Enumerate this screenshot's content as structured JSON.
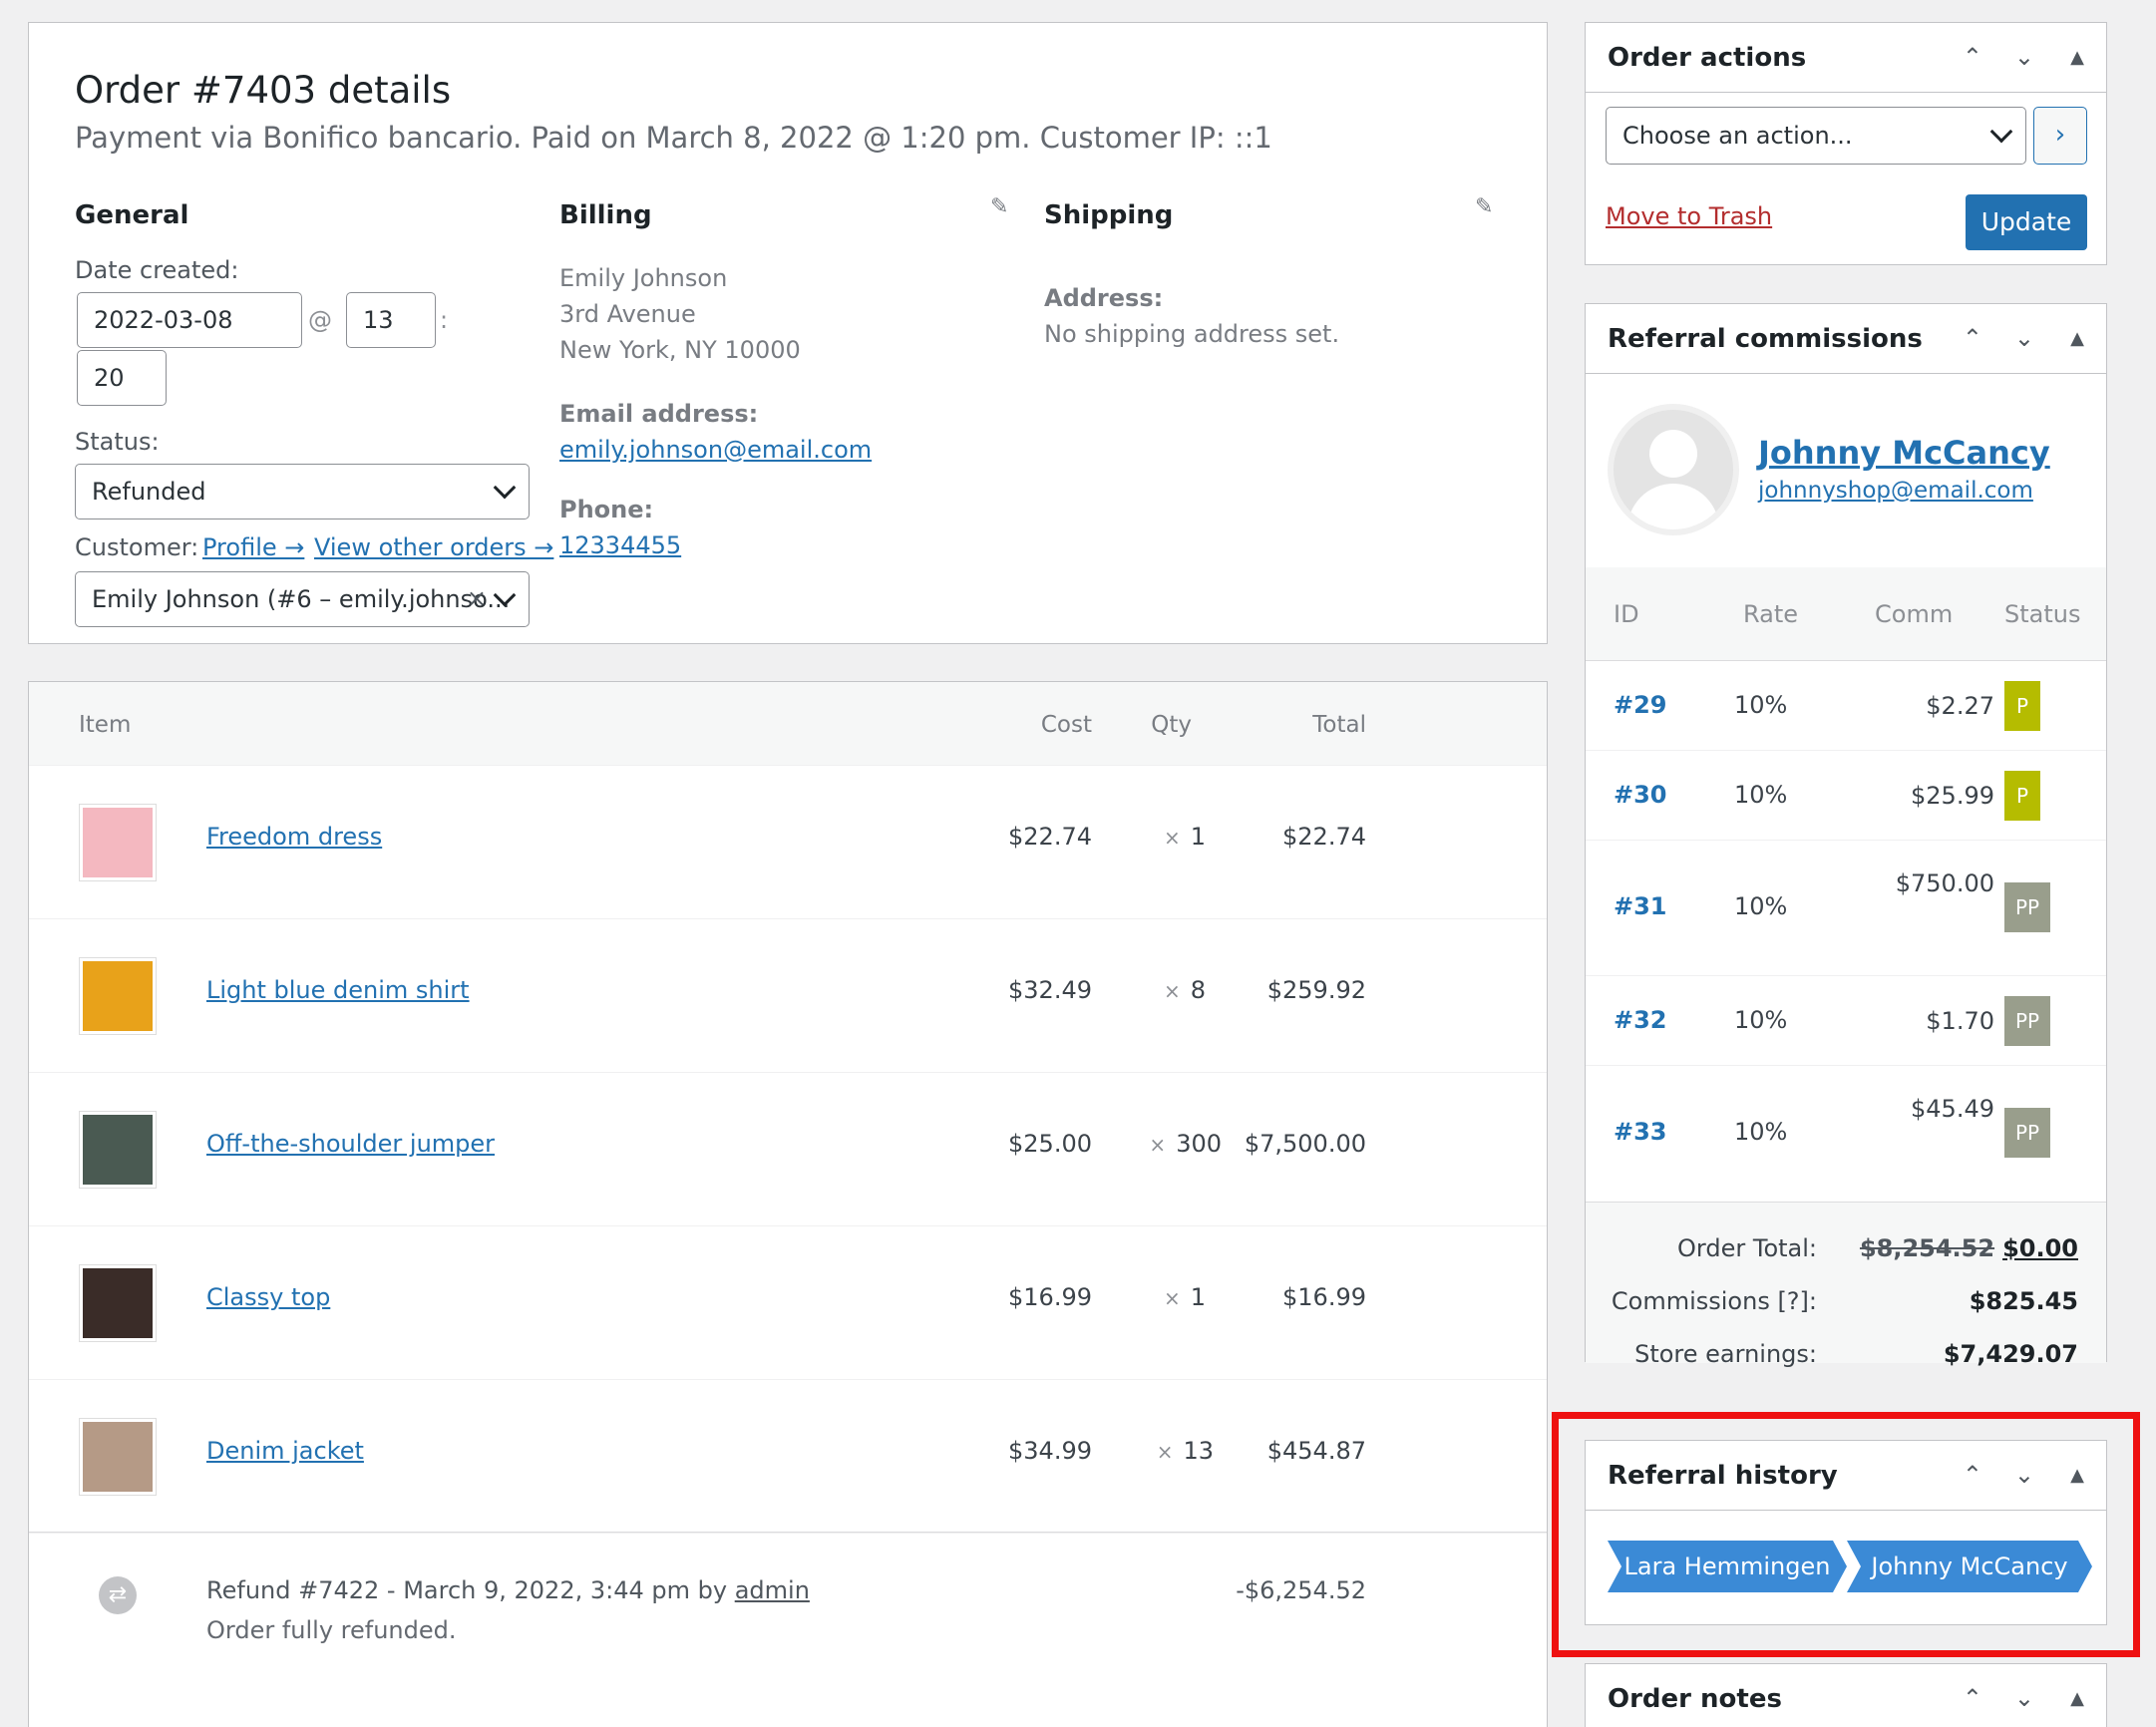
{
  "order": {
    "title": "Order #7403 details",
    "subtitle": "Payment via Bonifico bancario. Paid on March 8, 2022 @ 1:20 pm. Customer IP: ::1",
    "general": {
      "heading": "General",
      "date_label": "Date created:",
      "date": "2022-03-08",
      "at": "@",
      "hour": "13",
      "colon": ":",
      "minute": "20",
      "status_label": "Status:",
      "status": "Refunded",
      "customer_label": "Customer:",
      "profile_link": "Profile →",
      "other_orders_link": "View other orders →",
      "customer": "Emily Johnson (#6 – emily.johnso...",
      "clear": "×"
    },
    "billing": {
      "heading": "Billing",
      "name": "Emily Johnson",
      "street": "3rd Avenue",
      "city": "New York, NY 10000",
      "email_label": "Email address:",
      "email": "emily.johnson@email.com",
      "phone_label": "Phone:",
      "phone": "12334455",
      "edit_icon": "pencil-icon"
    },
    "shipping": {
      "heading": "Shipping",
      "address_label": "Address:",
      "address": "No shipping address set.",
      "edit_icon": "pencil-icon"
    }
  },
  "items": {
    "headers": {
      "item": "Item",
      "cost": "Cost",
      "qty": "Qty",
      "total": "Total"
    },
    "qty_prefix": "×",
    "rows": [
      {
        "name": "Freedom dress",
        "cost": "$22.74",
        "qty": "1",
        "total": "$22.74",
        "thumb_color": "#f4b8c0"
      },
      {
        "name": "Light blue denim shirt",
        "cost": "$32.49",
        "qty": "8",
        "total": "$259.92",
        "thumb_color": "#e8a21a"
      },
      {
        "name": "Off-the-shoulder jumper",
        "cost": "$25.00",
        "qty": "300",
        "total": "$7,500.00",
        "thumb_color": "#4a5a52"
      },
      {
        "name": "Classy top",
        "cost": "$16.99",
        "qty": "1",
        "total": "$16.99",
        "thumb_color": "#3a2c28"
      },
      {
        "name": "Denim jacket",
        "cost": "$34.99",
        "qty": "13",
        "total": "$454.87",
        "thumb_color": "#b59a86"
      }
    ],
    "refund": {
      "text": "Refund #7422 - March 9, 2022, 3:44 pm by",
      "by": "admin",
      "note": "Order fully refunded.",
      "amount": "-$6,254.52",
      "icon": "refund-icon"
    }
  },
  "sidebar": {
    "actions": {
      "title": "Order actions",
      "select": "Choose an action...",
      "go": "›",
      "trash": "Move to Trash",
      "update": "Update"
    },
    "referral": {
      "title": "Referral commissions",
      "affiliate_name": "Johnny McCancy",
      "affiliate_email": "johnnyshop@email.com",
      "headers": {
        "id": "ID",
        "rate": "Rate",
        "comm": "Comm",
        "status": "Status"
      },
      "rows": [
        {
          "id": "#29",
          "rate": "10%",
          "comm": "$2.27",
          "status": "P"
        },
        {
          "id": "#30",
          "rate": "10%",
          "comm": "$25.99",
          "status": "P"
        },
        {
          "id": "#31",
          "rate": "10%",
          "comm": "$750.00",
          "status": "PP"
        },
        {
          "id": "#32",
          "rate": "10%",
          "comm": "$1.70",
          "status": "PP"
        },
        {
          "id": "#33",
          "rate": "10%",
          "comm": "$45.49",
          "status": "PP"
        }
      ],
      "order_total_label": "Order Total:",
      "order_total_old": "$8,254.52",
      "order_total_new": "$0.00",
      "commissions_label": "Commissions [?]:",
      "commissions": "$825.45",
      "earnings_label": "Store earnings:",
      "earnings": "$7,429.07",
      "status_colors": {
        "P": "#b5bc00",
        "PP": "#999e8c"
      }
    },
    "history": {
      "title": "Referral history",
      "items": [
        "Lara Hemmingen",
        "Johnny McCancy"
      ],
      "crumb_color": "#3b8ad6",
      "highlight_color": "#ee1111"
    },
    "notes": {
      "title": "Order notes"
    },
    "controls": {
      "up": "⌃",
      "down": "⌄",
      "toggle": "▲"
    }
  }
}
